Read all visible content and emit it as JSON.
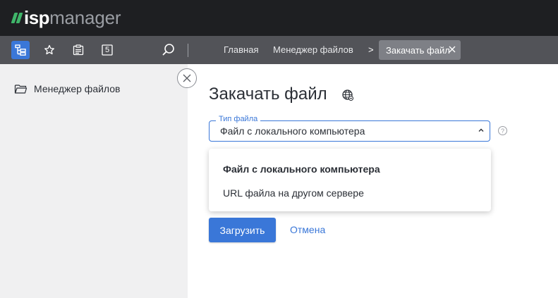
{
  "app": {
    "logo_isp": "isp",
    "logo_manager": "manager"
  },
  "toolbar": {
    "buttons": [
      {
        "name": "tree-view",
        "icon": "tree-icon",
        "active": true
      },
      {
        "name": "favorites",
        "icon": "star-icon",
        "active": false
      },
      {
        "name": "tasks",
        "icon": "clipboard-icon",
        "active": false
      },
      {
        "name": "counter",
        "icon": "counter-icon",
        "label": "5",
        "active": false
      }
    ],
    "search_icon": "search-icon"
  },
  "breadcrumbs": {
    "items": [
      "Главная",
      "Менеджер файлов"
    ],
    "separator": ">",
    "active": "Закачать файл"
  },
  "sidebar": {
    "items": [
      {
        "icon": "folder-icon",
        "label": "Менеджер файлов"
      }
    ]
  },
  "form": {
    "title": "Закачать файл",
    "title_icon": "globe-icon",
    "file_type": {
      "legend": "Тип файла",
      "value": "Файл с локального компьютера",
      "options": [
        "Файл с локального компьютера",
        "URL файла на другом сервере"
      ],
      "selected_index": 0
    },
    "help": "?",
    "submit_label": "Загрузить",
    "cancel_label": "Отмена"
  },
  "colors": {
    "accent": "#3a77d8",
    "topbar": "#1e1f22",
    "toolbar": "#525358",
    "sidebar": "#f0f0f1",
    "logo_green": "#3fb66a"
  }
}
